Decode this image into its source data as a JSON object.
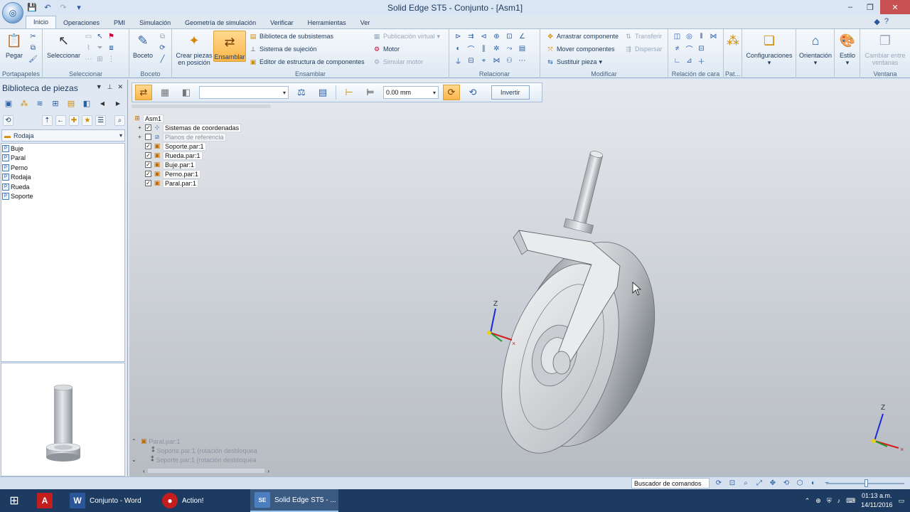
{
  "window": {
    "title": "Solid Edge ST5 - Conjunto - [Asm1]",
    "controls": [
      "–",
      "❐",
      "✕"
    ]
  },
  "ribbon": {
    "tabs": [
      "Inicio",
      "Operaciones",
      "PMI",
      "Simulación",
      "Geometría de simulación",
      "Verificar",
      "Herramientas",
      "Ver"
    ],
    "groups": {
      "portapapeles": {
        "label": "Portapapeles",
        "pegar": "Pegar"
      },
      "seleccionar": {
        "label": "Seleccionar",
        "seleccionar": "Seleccionar"
      },
      "boceto": {
        "label": "Boceto",
        "boceto": "Boceto"
      },
      "ensamblar": {
        "label": "Ensamblar",
        "crear_piezas": "Crear piezas en posición",
        "ensamblar": "Ensamblar",
        "biblioteca": "Biblioteca de subsistemas",
        "sistema_sujecion": "Sistema de sujeción",
        "editor": "Editor de estructura de componentes",
        "publicacion": "Publicación virtual",
        "motor": "Motor",
        "simular_motor": "Simular motor"
      },
      "relacionar": {
        "label": "Relacionar"
      },
      "modificar": {
        "label": "Modificar",
        "arrastrar": "Arrastrar componente",
        "mover": "Mover componentes",
        "sustituir": "Sustituir pieza",
        "transferir": "Transferir",
        "dispersar": "Dispersar"
      },
      "relacion_cara": {
        "label": "Relación de cara"
      },
      "pat": {
        "label": "Pat..."
      },
      "configuraciones": {
        "label": "Configuraciones"
      },
      "orientacion": {
        "label": "Orientación"
      },
      "estilo": {
        "label": "Estilo"
      },
      "ventana": {
        "label": "Ventana",
        "cambiar": "Cambiar entre ventanas"
      }
    }
  },
  "leftpane": {
    "title": "Biblioteca de piezas",
    "folder": "Rodaja",
    "items": [
      "Buje",
      "Paral",
      "Perno",
      "Rodaja",
      "Rueda",
      "Soporte"
    ]
  },
  "commandbar": {
    "offset_value": "0.00 mm",
    "invert_label": "Invertir"
  },
  "pathfinder": {
    "root": "Asm1",
    "rows": [
      {
        "label": "Sistemas de coordenadas",
        "expand": "+",
        "checked": "✓"
      },
      {
        "label": "Planos de referencia",
        "expand": "+",
        "checked": ""
      },
      {
        "label": "Soporte.par:1",
        "expand": "",
        "checked": "✓"
      },
      {
        "label": "Rueda.par:1",
        "expand": "",
        "checked": "✓"
      },
      {
        "label": "Buje.par:1",
        "expand": "",
        "checked": "✓"
      },
      {
        "label": "Perno.par:1",
        "expand": "",
        "checked": "✓"
      },
      {
        "label": "Paral.par:1",
        "expand": "",
        "checked": "✓"
      }
    ]
  },
  "relationships": {
    "root": "Paral.par:1",
    "rows": [
      "Soporte.par:1  (rotación desbloquea",
      "Soporte.par:1  (rotación desbloquea"
    ]
  },
  "axes": {
    "z": "Z"
  },
  "statusbar": {
    "command_finder": "Buscador de comandos"
  },
  "taskbar": {
    "apps": [
      {
        "label": "Conjunto - Word",
        "color": "#2b579a",
        "glyph": "W"
      },
      {
        "label": "Action!",
        "color": "#c41d1d",
        "glyph": "●"
      },
      {
        "label": "Solid Edge ST5 - ...",
        "color": "#4c7fc0",
        "glyph": "SE"
      }
    ],
    "time": "01:13 a.m.",
    "date": "14/11/2016"
  },
  "colors": {
    "accent": "#fbb54a",
    "ribbon": "#dde8f3",
    "taskbar": "#1d3b60"
  }
}
